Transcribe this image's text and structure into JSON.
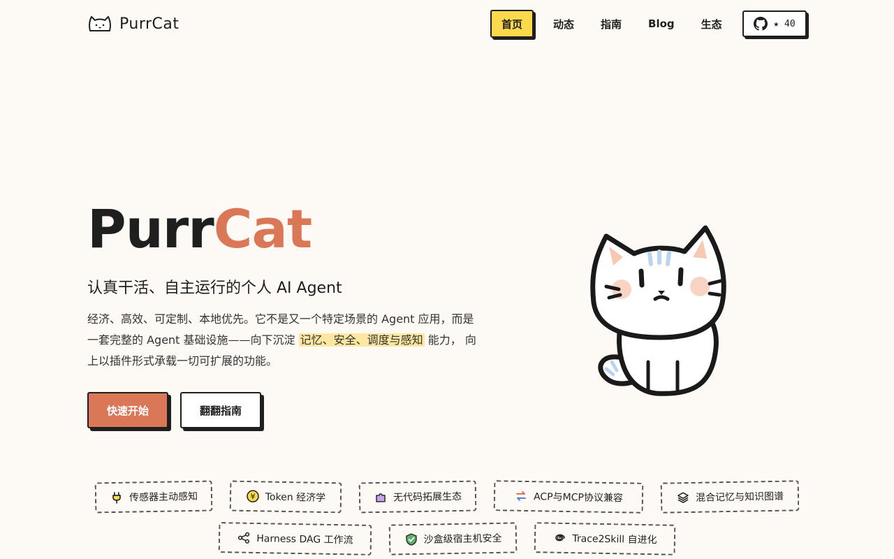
{
  "brand": {
    "name": "PurrCat",
    "logo_icon": "cat-logo-icon"
  },
  "nav": {
    "items": [
      {
        "label": "首页",
        "active": true
      },
      {
        "label": "动态",
        "active": false
      },
      {
        "label": "指南",
        "active": false
      },
      {
        "label": "Blog",
        "active": false
      },
      {
        "label": "生态",
        "active": false
      }
    ],
    "github": {
      "icon": "github-icon",
      "stars": "★ 40"
    }
  },
  "hero": {
    "title_part1": "Purr",
    "title_part2": "Cat",
    "subtitle": "认真干活、自主运行的个人 AI Agent",
    "desc_before": "经济、高效、可定制、本地优先。它不是又一个特定场景的 Agent 应用，而是一套完整的 Agent 基础设施——向下沉淀",
    "desc_highlight": "记忆、安全、调度与感知",
    "desc_after": "能力， 向上以插件形式承载一切可扩展的功能。",
    "cta_primary": "快速开始",
    "cta_secondary": "翻翻指南",
    "mascot": "cat-mascot-illustration"
  },
  "features": [
    {
      "label": "传感器主动感知",
      "icon": "plug-icon"
    },
    {
      "label": "Token 经济学",
      "icon": "yen-coin-icon"
    },
    {
      "label": "无代码拓展生态",
      "icon": "puzzle-icon"
    },
    {
      "label": "ACP与MCP协议兼容",
      "icon": "swap-arrows-icon"
    },
    {
      "label": "混合记忆与知识图谱",
      "icon": "layers-icon"
    },
    {
      "label": "Harness DAG 工作流",
      "icon": "workflow-icon"
    },
    {
      "label": "沙盒级宿主机安全",
      "icon": "shield-check-icon"
    },
    {
      "label": "Trace2Skill 自进化",
      "icon": "spiral-icon"
    }
  ],
  "colors": {
    "accent": "#d97757",
    "highlight": "#fde7a1",
    "active_nav": "#fbd94a",
    "background": "#fdf9f4"
  }
}
